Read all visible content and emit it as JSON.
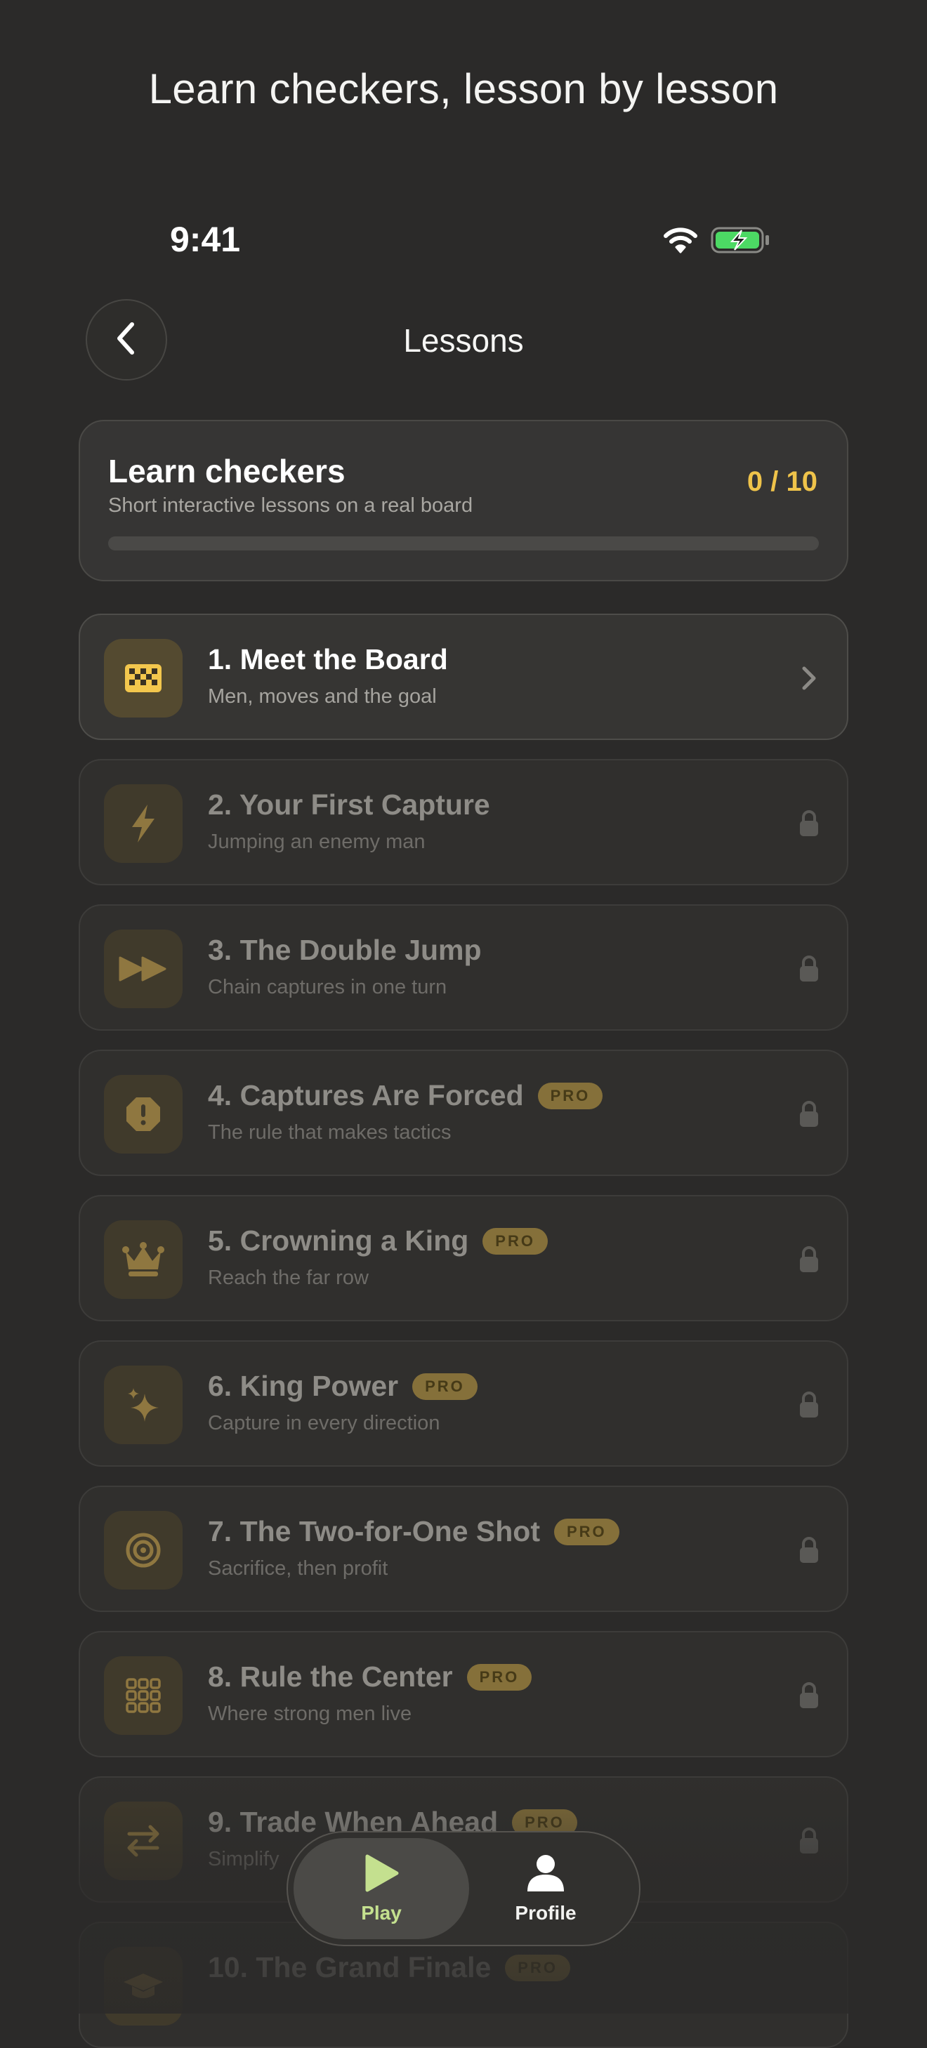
{
  "headline": "Learn checkers, lesson by lesson",
  "status_bar": {
    "time": "9:41",
    "wifi_icon": "wifi-icon",
    "battery_icon": "battery-charging-icon"
  },
  "nav": {
    "title": "Lessons",
    "back_icon": "chevron-left-icon"
  },
  "progress": {
    "title": "Learn checkers",
    "subtitle": "Short interactive lessons on a real board",
    "count_label": "0 / 10",
    "completed": 0,
    "total": 10
  },
  "lessons": [
    {
      "title": "1. Meet the Board",
      "subtitle": "Men, moves and the goal",
      "icon": "checkerboard-icon",
      "status": "open"
    },
    {
      "title": "2. Your First Capture",
      "subtitle": "Jumping an enemy man",
      "icon": "lightning-icon",
      "status": "locked"
    },
    {
      "title": "3. The Double Jump",
      "subtitle": "Chain captures in one turn",
      "icon": "fast-forward-icon",
      "status": "locked"
    },
    {
      "title": "4. Captures Are Forced",
      "subtitle": "The rule that makes tactics",
      "icon": "alert-octagon-icon",
      "status": "locked",
      "badge": "PRO"
    },
    {
      "title": "5. Crowning a King",
      "subtitle": "Reach the far row",
      "icon": "crown-icon",
      "status": "locked",
      "badge": "PRO"
    },
    {
      "title": "6. King Power",
      "subtitle": "Capture in every direction",
      "icon": "sparkles-icon",
      "status": "locked",
      "badge": "PRO"
    },
    {
      "title": "7. The Two-for-One Shot",
      "subtitle": "Sacrifice, then profit",
      "icon": "target-icon",
      "status": "locked",
      "badge": "PRO"
    },
    {
      "title": "8. Rule the Center",
      "subtitle": "Where strong men live",
      "icon": "grid-icon",
      "status": "locked",
      "badge": "PRO"
    },
    {
      "title": "9. Trade When Ahead",
      "subtitle": "Simplify",
      "icon": "swap-arrows-icon",
      "status": "locked",
      "badge": "PRO"
    },
    {
      "title": "10. The Grand Finale",
      "subtitle": "",
      "icon": "graduation-cap-icon",
      "status": "locked",
      "badge": "PRO"
    }
  ],
  "tab_bar": {
    "play": {
      "label": "Play",
      "icon": "play-icon",
      "selected": true
    },
    "profile": {
      "label": "Profile",
      "icon": "person-icon"
    }
  },
  "colors": {
    "background": "#2b2a29",
    "accent": "#efc34a",
    "play_tab": "#c4e08f",
    "battery": "#4cd964"
  }
}
